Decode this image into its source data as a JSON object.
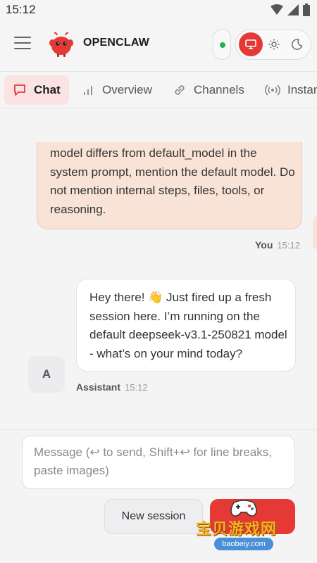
{
  "status_bar": {
    "time": "15:12"
  },
  "header": {
    "brand": "OPENCLAW",
    "connection_status": "connected"
  },
  "theme": {
    "options": [
      "system",
      "light",
      "dark"
    ],
    "selected": "system"
  },
  "tabs": [
    {
      "label": "Chat",
      "icon": "chat-bubble-icon",
      "active": true
    },
    {
      "label": "Overview",
      "icon": "bar-chart-icon",
      "active": false
    },
    {
      "label": "Channels",
      "icon": "link-icon",
      "active": false
    },
    {
      "label": "Instances",
      "icon": "broadcast-icon",
      "active": false
    }
  ],
  "messages": {
    "user": {
      "text": "model differs from default_model in the system prompt, mention the default model. Do not mention internal steps, files, tools, or reasoning.",
      "sender": "You",
      "time": "15:12"
    },
    "assistant": {
      "text": "Hey there! 👋 Just fired up a fresh session here. I’m running on the default deepseek-v3.1-250821 model - what’s on your mind today?",
      "sender": "Assistant",
      "time": "15:12",
      "avatar": "A"
    }
  },
  "composer": {
    "placeholder": "Message (↩ to send, Shift+↩ for line breaks, paste images)",
    "new_session_label": "New session"
  },
  "watermark": {
    "title": "宝贝游戏网",
    "url": "baobeiy.com"
  },
  "colors": {
    "accent": "#e53935",
    "user_bubble": "#f8e3d6",
    "status_ok": "#22b15a"
  }
}
